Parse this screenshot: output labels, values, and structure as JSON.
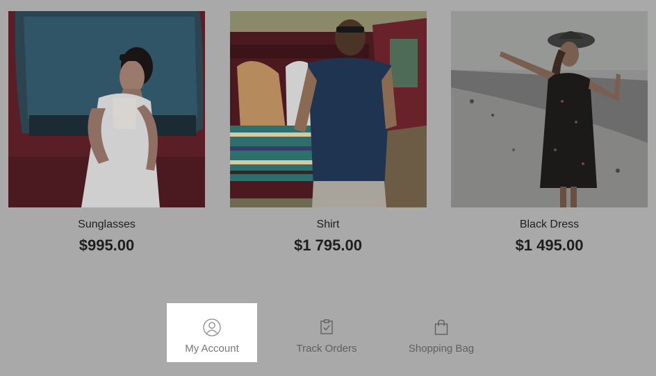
{
  "products": [
    {
      "name": "Sunglasses",
      "price": "$995.00",
      "image_alt": "woman-in-white-dress-by-van"
    },
    {
      "name": "Shirt",
      "price": "$1 795.00",
      "image_alt": "man-in-shirt-by-van"
    },
    {
      "name": "Black Dress",
      "price": "$1 495.00",
      "image_alt": "woman-in-black-dress-on-beach"
    }
  ],
  "nav": {
    "account_label": "My Account",
    "orders_label": "Track Orders",
    "bag_label": "Shopping Bag"
  },
  "colors": {
    "background": "#a9a9a9",
    "active_tab": "#ffffff",
    "text_dark": "#1e1e1e",
    "text_muted": "#5f5f5f"
  }
}
